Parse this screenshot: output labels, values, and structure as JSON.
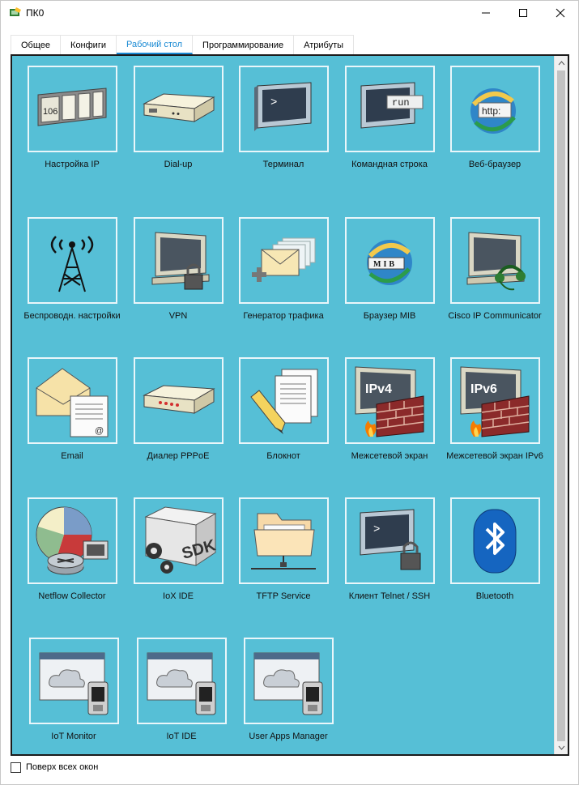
{
  "window": {
    "title": "ПК0"
  },
  "tabs": [
    {
      "label": "Общее",
      "active": false
    },
    {
      "label": "Конфиги",
      "active": false
    },
    {
      "label": "Рабочий стол",
      "active": true
    },
    {
      "label": "Программирование",
      "active": false
    },
    {
      "label": "Атрибуты",
      "active": false
    }
  ],
  "apps": [
    {
      "label": "Настройка IP",
      "icon": "ip-config-icon"
    },
    {
      "label": "Dial-up",
      "icon": "dialup-modem-icon"
    },
    {
      "label": "Терминал",
      "icon": "terminal-icon"
    },
    {
      "label": "Командная строка",
      "icon": "command-prompt-icon"
    },
    {
      "label": "Веб-браузер",
      "icon": "web-browser-icon"
    },
    {
      "label": "Беспроводн. настройки",
      "icon": "wireless-tower-icon"
    },
    {
      "label": "VPN",
      "icon": "vpn-lock-icon"
    },
    {
      "label": "Генератор трафика",
      "icon": "traffic-generator-icon"
    },
    {
      "label": "Браузер MIB",
      "icon": "mib-browser-icon"
    },
    {
      "label": "Cisco IP Communicator",
      "icon": "ip-communicator-headset-icon"
    },
    {
      "label": "Email",
      "icon": "email-envelope-icon"
    },
    {
      "label": "Диалер PPPoE",
      "icon": "pppoe-dialer-icon"
    },
    {
      "label": "Блокнот",
      "icon": "notepad-icon"
    },
    {
      "label": "Межсетевой экран",
      "icon": "firewall-ipv4-icon",
      "tag": "IPv4"
    },
    {
      "label": "Межсетевой экран IPv6",
      "icon": "firewall-ipv6-icon",
      "tag": "IPv6"
    },
    {
      "label": "Netflow Collector",
      "icon": "netflow-pie-icon"
    },
    {
      "label": "IoX IDE",
      "icon": "sdk-box-icon",
      "tag": "SDK"
    },
    {
      "label": "TFTP Service",
      "icon": "tftp-folder-icon"
    },
    {
      "label": "Клиент Telnet / SSH",
      "icon": "telnet-ssh-icon"
    },
    {
      "label": "Bluetooth",
      "icon": "bluetooth-icon"
    },
    {
      "label": "IoT Monitor",
      "icon": "iot-cloud-phone-icon"
    },
    {
      "label": "IoT IDE",
      "icon": "iot-cloud-phone-icon"
    },
    {
      "label": "User Apps Manager",
      "icon": "iot-cloud-phone-icon"
    }
  ],
  "icon_text": {
    "ip_number": "106",
    "terminal_prompt": ">",
    "run": "run",
    "http": "http:",
    "mib": "MIB",
    "at": "@"
  },
  "footer": {
    "always_on_top_label": "Поверх всех окон",
    "always_on_top_checked": false
  },
  "colors": {
    "desktop_bg": "#56bfd6",
    "tab_active": "#1a8ad4",
    "tile_border": "#e9f6fa"
  }
}
